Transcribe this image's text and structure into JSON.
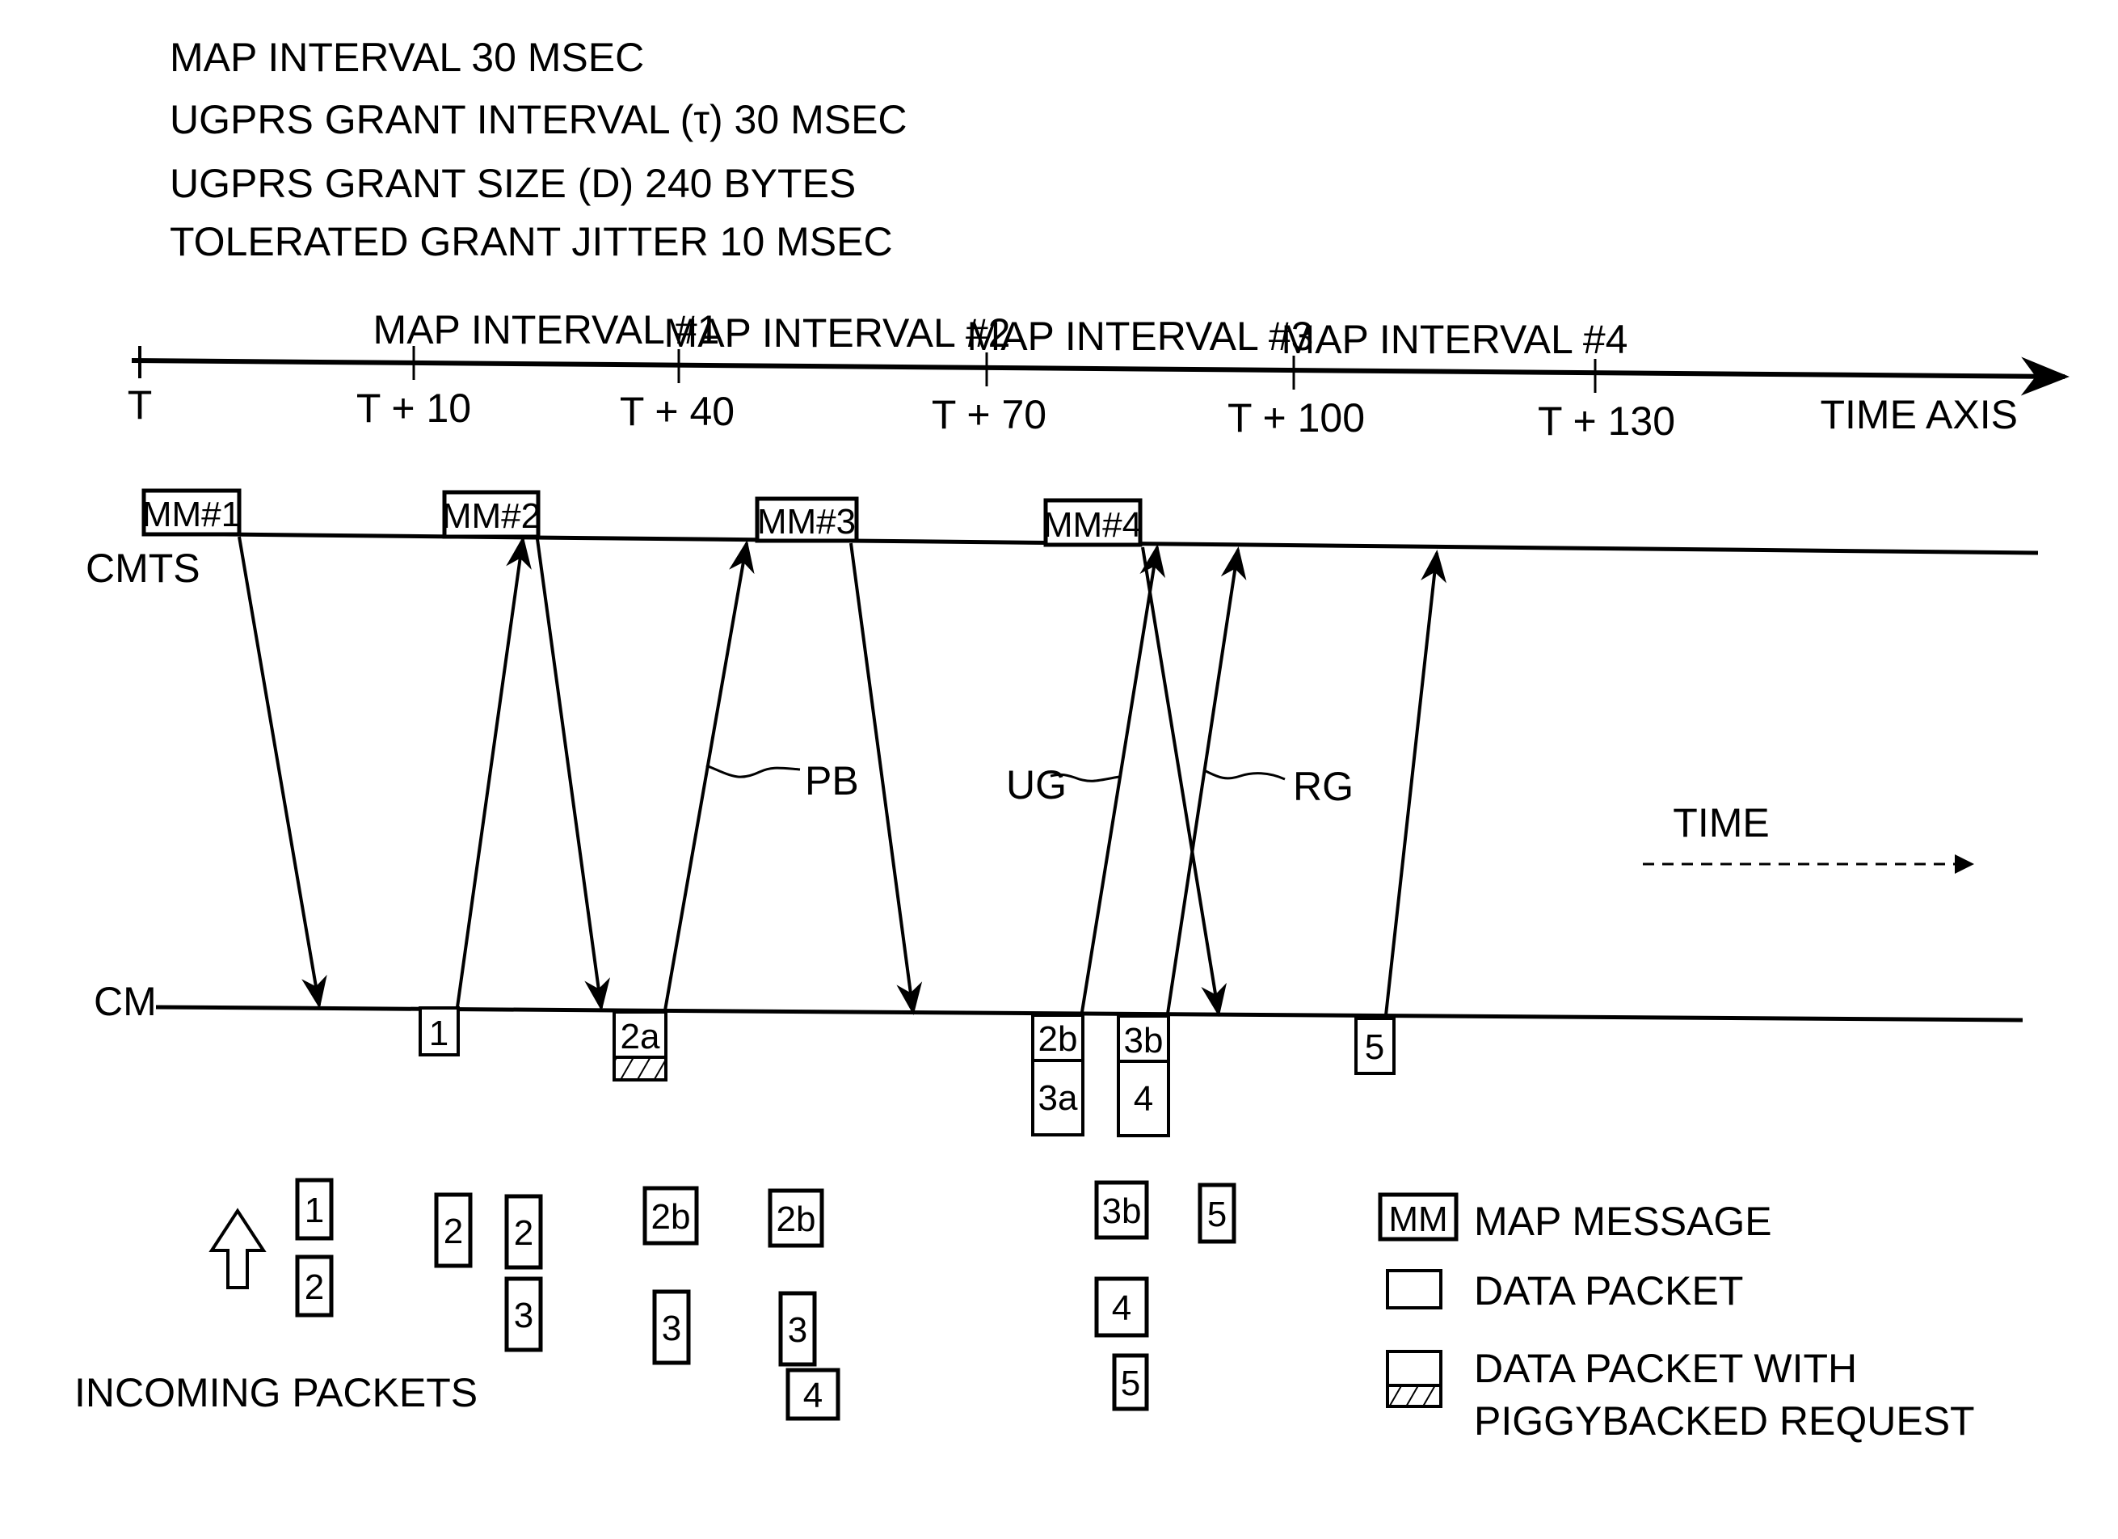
{
  "header": {
    "lines": [
      "MAP INTERVAL 30 MSEC",
      "UGPRS GRANT INTERVAL (τ) 30 MSEC",
      "UGPRS GRANT SIZE (D) 240 BYTES",
      "TOLERATED GRANT JITTER 10 MSEC"
    ]
  },
  "time_axis": {
    "label": "TIME AXIS",
    "ticks": [
      "T",
      "T + 10",
      "T + 40",
      "T + 70",
      "T + 100",
      "T + 130"
    ],
    "intervals": [
      "MAP INTERVAL #1",
      "MAP INTERVAL #2",
      "MAP INTERVAL #3",
      "MAP INTERVAL #4"
    ]
  },
  "lanes": {
    "cmts": "CMTS",
    "cm": "CM"
  },
  "map_messages": [
    "MM#1",
    "MM#2",
    "MM#3",
    "MM#4"
  ],
  "arrow_labels": {
    "pb": "PB",
    "ug": "UG",
    "rg": "RG"
  },
  "cm_packets": [
    {
      "label": "1"
    },
    {
      "label": "2a",
      "piggyback": true
    },
    {
      "label": "2b"
    },
    {
      "label": "3a"
    },
    {
      "label": "3b"
    },
    {
      "label": "4"
    },
    {
      "label": "5"
    }
  ],
  "incoming": {
    "label": "INCOMING PACKETS",
    "columns": [
      [
        "1",
        "2"
      ],
      [
        "2"
      ],
      [
        "2",
        "3"
      ],
      [
        "2b",
        "3"
      ],
      [
        "2b",
        "3",
        "4"
      ],
      [
        "3b",
        "4",
        "5"
      ],
      [
        "5"
      ]
    ]
  },
  "time_indicator": "TIME",
  "legend": {
    "mm_symbol": "MM",
    "items": [
      "MAP MESSAGE",
      "DATA PACKET",
      "DATA PACKET WITH",
      "PIGGYBACKED REQUEST"
    ]
  }
}
